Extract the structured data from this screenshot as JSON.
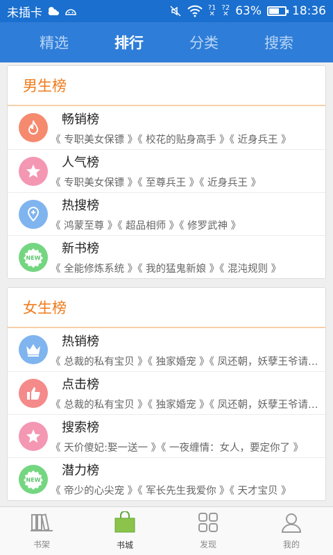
{
  "statusbar": {
    "carrier": "未插卡",
    "battery_percent": "63%",
    "battery_level": 0.63,
    "time": "18:36",
    "signal1": "?1",
    "signal2": "?2"
  },
  "top_tabs": [
    "精选",
    "排行",
    "分类",
    "搜索"
  ],
  "active_tab": 1,
  "sections": [
    {
      "title": "男生榜",
      "items": [
        {
          "title": "畅销榜",
          "subtitle": "《 专职美女保镖 》《 校花的贴身高手 》《 近身兵王 》",
          "icon": "flame-icon",
          "color": "#f58a6e"
        },
        {
          "title": "人气榜",
          "subtitle": "《 专职美女保镖 》《 至尊兵王 》《 近身兵王 》",
          "icon": "star-icon",
          "color": "#f497b3"
        },
        {
          "title": "热搜榜",
          "subtitle": "《 鸿蒙至尊 》《 超品相师 》《 修罗武神 》",
          "icon": "location-pin-icon",
          "color": "#7fb4ef"
        },
        {
          "title": "新书榜",
          "subtitle": "《 全能修炼系统 》《 我的猛鬼新娘 》《 混沌规则 》",
          "icon": "new-badge-icon",
          "color": "#74d681"
        }
      ]
    },
    {
      "title": "女生榜",
      "items": [
        {
          "title": "热销榜",
          "subtitle": "《 总裁的私有宝贝 》《 独家婚宠 》《 凤还朝，妖孽王爷请让道 》",
          "icon": "crown-icon",
          "color": "#7fb4ef"
        },
        {
          "title": "点击榜",
          "subtitle": "《 总裁的私有宝贝 》《 独家婚宠 》《 凤还朝，妖孽王爷请让道 》",
          "icon": "thumbs-up-icon",
          "color": "#f58a8a"
        },
        {
          "title": "搜索榜",
          "subtitle": "《 天价傻妃:娶一送一 》《 一夜缠情：女人，要定你了 》",
          "icon": "star-icon",
          "color": "#f497b3"
        },
        {
          "title": "潜力榜",
          "subtitle": "《 帝少的心尖宠 》《 军长先生我爱你 》《 天才宝贝 》",
          "icon": "new-badge-icon",
          "color": "#74d681"
        }
      ]
    }
  ],
  "bottom_nav": [
    {
      "label": "书架",
      "icon": "bookshelf-icon"
    },
    {
      "label": "书城",
      "icon": "shopping-bag-icon"
    },
    {
      "label": "发现",
      "icon": "grid-icon"
    },
    {
      "label": "我的",
      "icon": "user-icon"
    }
  ],
  "active_bottom": 1
}
